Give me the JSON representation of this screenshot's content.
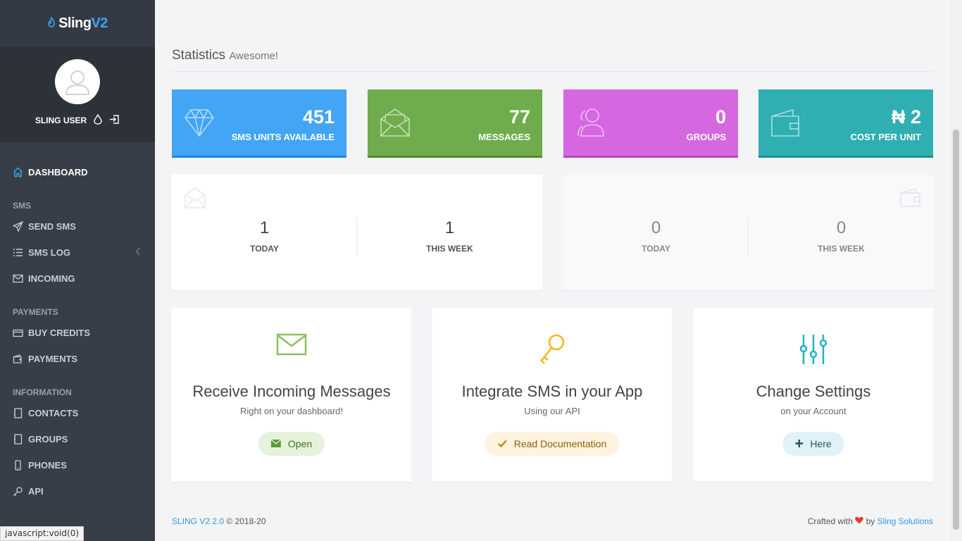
{
  "brand": {
    "part1": "Sling",
    "part2": "V2"
  },
  "user": {
    "name": "SLING USER"
  },
  "nav": {
    "dashboard": "DASHBOARD",
    "sms_header": "SMS",
    "send_sms": "SEND SMS",
    "sms_log": "SMS LOG",
    "incoming": "INCOMING",
    "payments_header": "PAYMENTS",
    "buy_credits": "BUY CREDITS",
    "payments": "PAYMENTS",
    "information_header": "INFORMATION",
    "contacts": "CONTACTS",
    "groups": "GROUPS",
    "phones": "PHONES",
    "api": "API"
  },
  "status_tip": "javascript:void(0)",
  "page": {
    "title": "Statistics",
    "subtitle": "Awesome!"
  },
  "stats": [
    {
      "value": "451",
      "label": "SMS UNITS AVAILABLE",
      "color": "#42a5f5"
    },
    {
      "value": "77",
      "label": "MESSAGES",
      "color": "#6fad4c"
    },
    {
      "value": "0",
      "label": "GROUPS",
      "color": "#d567e0"
    },
    {
      "value": "₦ 2",
      "label": "COST PER UNIT",
      "color": "#2fafb2"
    }
  ],
  "messages_panel": {
    "today_value": "1",
    "today_label": "TODAY",
    "week_value": "1",
    "week_label": "THIS WEEK"
  },
  "payments_panel": {
    "today_value": "0",
    "today_label": "TODAY",
    "week_value": "0",
    "week_label": "THIS WEEK"
  },
  "cards": [
    {
      "title": "Receive Incoming Messages",
      "subtitle": "Right on your dashboard!",
      "button": "Open"
    },
    {
      "title": "Integrate SMS in your App",
      "subtitle": "Using our API",
      "button": "Read Documentation"
    },
    {
      "title": "Change Settings",
      "subtitle": "on your Account",
      "button": "Here"
    }
  ],
  "footer": {
    "version_link": "SLING V2 2.0",
    "copyright": "© 2018-20",
    "crafted": "Crafted with",
    "by": "by",
    "company": "Sling Solutions"
  }
}
